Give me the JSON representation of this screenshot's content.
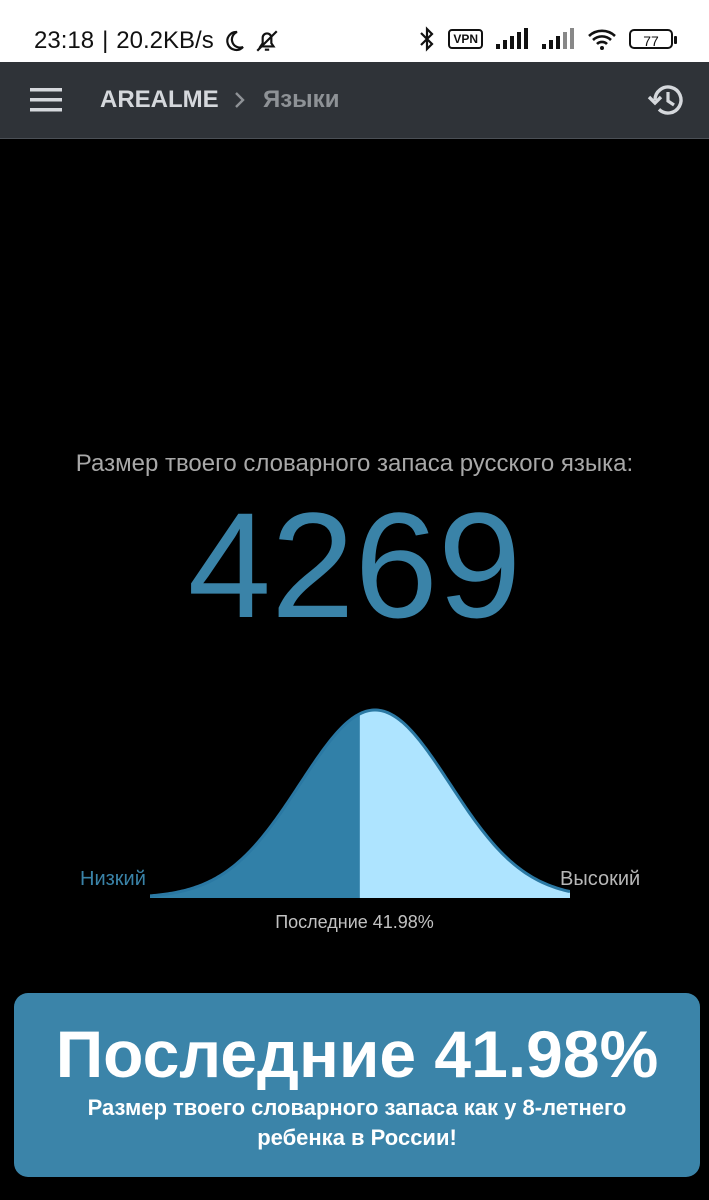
{
  "status_bar": {
    "time": "23:18",
    "separator": "|",
    "net_speed": "20.2KB/s",
    "vpn_label": "VPN",
    "battery_level": "77",
    "icons": [
      "moon-icon",
      "bell-off-icon",
      "bluetooth-icon",
      "signal-icon",
      "wifi-icon",
      "battery-icon"
    ]
  },
  "header": {
    "brand": "AREALME",
    "breadcrumb": "Языки",
    "icons": [
      "menu-icon",
      "chevron-right-icon",
      "history-icon"
    ]
  },
  "result": {
    "label": "Размер твоего словарного запаса русского языка:",
    "score": "4269",
    "scale_low": "Низкий",
    "scale_high": "Высокий",
    "percentile_caption": "Последние 41.98%",
    "percentile": 41.98
  },
  "card": {
    "title": "Последние 41.98%",
    "description": "Размер твоего словарного запаса как у 8-летнего ребенка в России!"
  },
  "colors": {
    "accent": "#3b84a9",
    "curve_light": "#aee4ff",
    "curve_dark": "#3180a8",
    "app_bar": "#2f3338"
  }
}
